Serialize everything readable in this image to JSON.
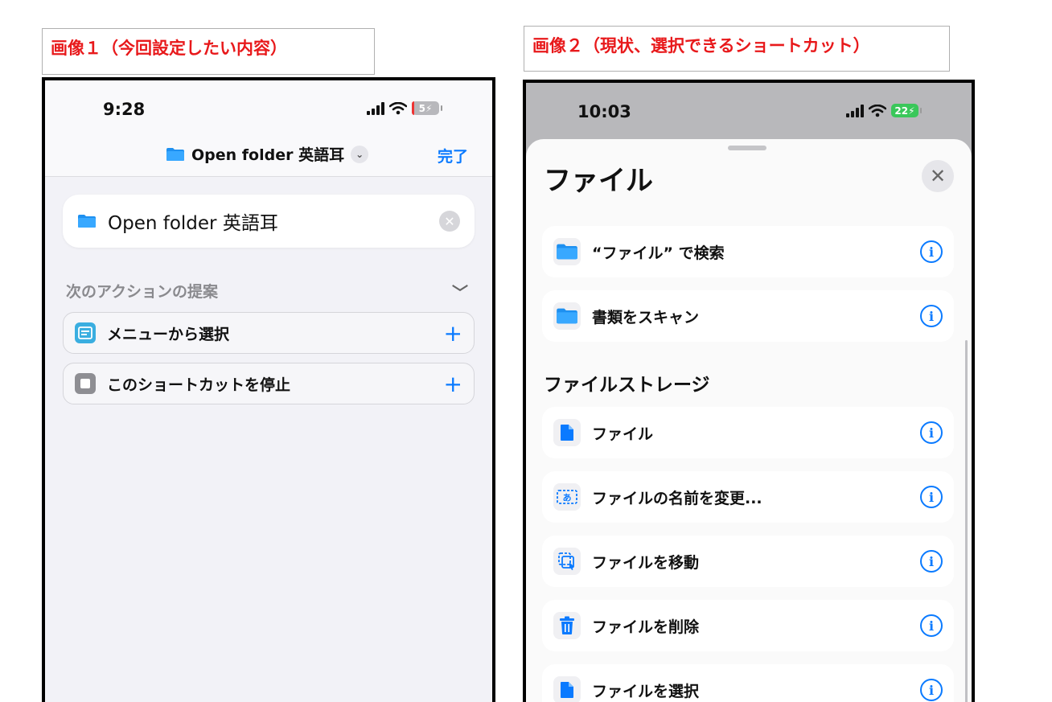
{
  "captions": {
    "image1": "画像１（今回設定したい内容）",
    "image2": "画像２（現状、選択できるショートカット）"
  },
  "phone1": {
    "time": "9:28",
    "battery": "5",
    "nav_title": "Open folder 英語耳",
    "done_label": "完了",
    "action_text": "Open folder 英語耳",
    "suggestions_header": "次のアクションの提案",
    "suggestions": [
      {
        "label": "メニューから選択",
        "icon": "menu-icon",
        "color": "#3aaee0"
      },
      {
        "label": "このショートカットを停止",
        "icon": "stop-icon",
        "color": "#8e8e93"
      }
    ]
  },
  "phone2": {
    "time": "10:03",
    "battery": "22",
    "sheet_title": "ファイル",
    "top_rows": [
      {
        "label": "“ファイル” で検索",
        "icon": "folder-icon"
      },
      {
        "label": "書類をスキャン",
        "icon": "folder-icon"
      }
    ],
    "section_title": "ファイルストレージ",
    "storage_rows": [
      {
        "label": "ファイル",
        "icon": "document-icon"
      },
      {
        "label": "ファイルの名前を変更...",
        "icon": "rename-icon"
      },
      {
        "label": "ファイルを移動",
        "icon": "move-icon"
      },
      {
        "label": "ファイルを削除",
        "icon": "trash-icon"
      },
      {
        "label": "ファイルを選択",
        "icon": "document-icon"
      }
    ]
  },
  "colors": {
    "accent": "#0a7aff",
    "caption_red": "#e8191b",
    "folder_blue": "#1e90f0"
  }
}
